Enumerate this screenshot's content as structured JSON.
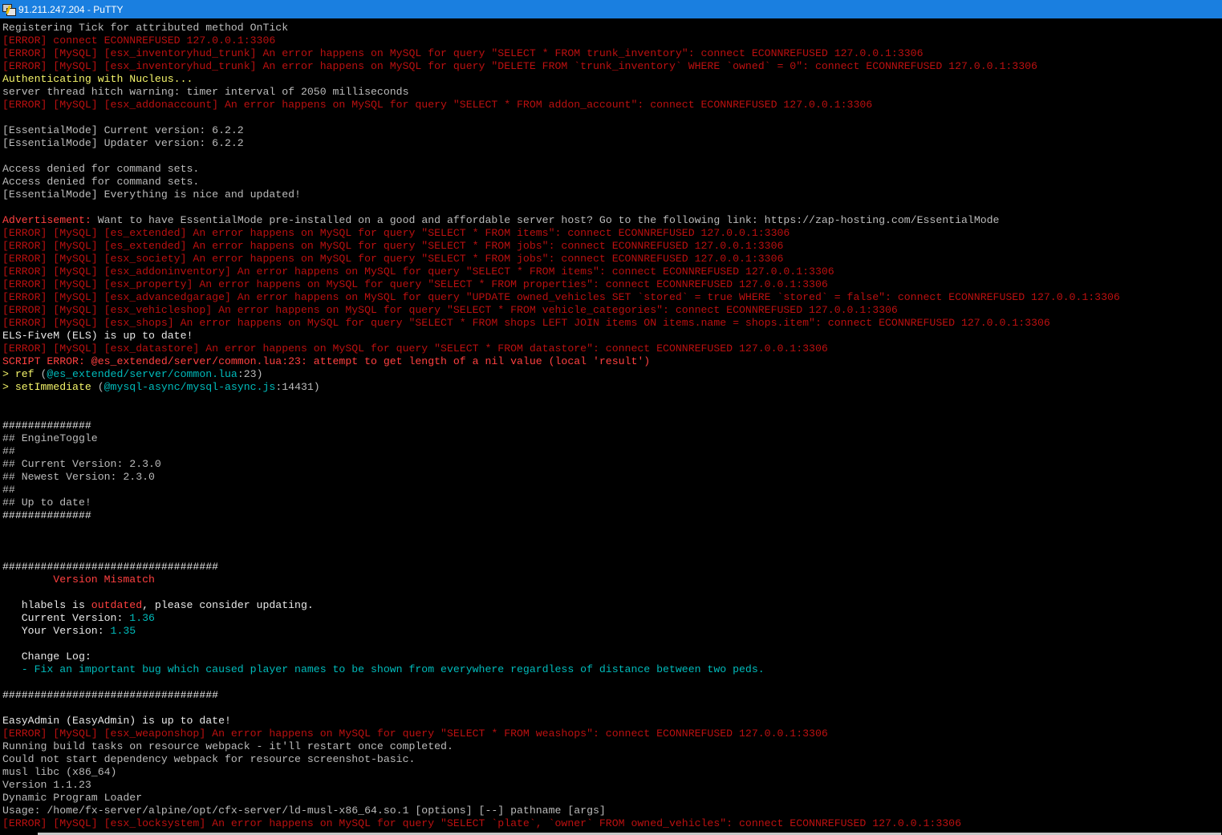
{
  "window": {
    "title": "91.211.247.204 - PuTTY",
    "icon": "putty-icon"
  },
  "colors": {
    "title_bar": "#1a7fe0",
    "background": "#000000",
    "default_text": "#bbbbbb",
    "error_red": "#bb1010",
    "script_error": "#ff4040",
    "yellow": "#f4f46a",
    "cyan": "#00bbbb"
  },
  "console": {
    "lines": [
      [
        {
          "t": "Registering Tick for attributed method OnTick",
          "c": "white"
        }
      ],
      [
        {
          "t": "[ERROR] connect ECONNREFUSED 127.0.0.1:3306",
          "c": "red"
        }
      ],
      [
        {
          "t": "[ERROR] [MySQL] [esx_inventoryhud_trunk] An error happens on MySQL for query \"SELECT * FROM trunk_inventory\": connect ECONNREFUSED 127.0.0.1:3306",
          "c": "red"
        }
      ],
      [
        {
          "t": "[ERROR] [MySQL] [esx_inventoryhud_trunk] An error happens on MySQL for query \"DELETE FROM `trunk_inventory` WHERE `owned` = 0\": connect ECONNREFUSED 127.0.0.1:3306",
          "c": "red"
        }
      ],
      [
        {
          "t": "Authenticating with Nucleus...",
          "c": "yellow"
        }
      ],
      [
        {
          "t": "server thread hitch warning: timer interval of 2050 milliseconds",
          "c": "white"
        }
      ],
      [
        {
          "t": "[ERROR] [MySQL] [esx_addonaccount] An error happens on MySQL for query \"SELECT * FROM addon_account\": connect ECONNREFUSED 127.0.0.1:3306",
          "c": "red"
        }
      ],
      [],
      [
        {
          "t": "[EssentialMode] Current version: 6.2.2",
          "c": "white"
        }
      ],
      [
        {
          "t": "[EssentialMode] Updater version: 6.2.2",
          "c": "white"
        }
      ],
      [],
      [
        {
          "t": "Access denied for command sets.",
          "c": "white"
        }
      ],
      [
        {
          "t": "Access denied for command sets.",
          "c": "white"
        }
      ],
      [
        {
          "t": "[EssentialMode] Everything is nice and updated!",
          "c": "white"
        }
      ],
      [],
      [
        {
          "t": "Advertisement:",
          "c": "bred"
        },
        {
          "t": " Want to have EssentialMode pre-installed on a good and affordable server host? Go to the following link: https://zap-hosting.com/EssentialMode",
          "c": "white"
        }
      ],
      [
        {
          "t": "[ERROR] [MySQL] [es_extended] An error happens on MySQL for query \"SELECT * FROM items\": connect ECONNREFUSED 127.0.0.1:3306",
          "c": "red"
        }
      ],
      [
        {
          "t": "[ERROR] [MySQL] [es_extended] An error happens on MySQL for query \"SELECT * FROM jobs\": connect ECONNREFUSED 127.0.0.1:3306",
          "c": "red"
        }
      ],
      [
        {
          "t": "[ERROR] [MySQL] [esx_society] An error happens on MySQL for query \"SELECT * FROM jobs\": connect ECONNREFUSED 127.0.0.1:3306",
          "c": "red"
        }
      ],
      [
        {
          "t": "[ERROR] [MySQL] [esx_addoninventory] An error happens on MySQL for query \"SELECT * FROM items\": connect ECONNREFUSED 127.0.0.1:3306",
          "c": "red"
        }
      ],
      [
        {
          "t": "[ERROR] [MySQL] [esx_property] An error happens on MySQL for query \"SELECT * FROM properties\": connect ECONNREFUSED 127.0.0.1:3306",
          "c": "red"
        }
      ],
      [
        {
          "t": "[ERROR] [MySQL] [esx_advancedgarage] An error happens on MySQL for query \"UPDATE owned_vehicles SET `stored` = true WHERE `stored` = false\": connect ECONNREFUSED 127.0.0.1:3306",
          "c": "red"
        }
      ],
      [
        {
          "t": "[ERROR] [MySQL] [esx_vehicleshop] An error happens on MySQL for query \"SELECT * FROM vehicle_categories\": connect ECONNREFUSED 127.0.0.1:3306",
          "c": "red"
        }
      ],
      [
        {
          "t": "[ERROR] [MySQL] [esx_shops] An error happens on MySQL for query \"SELECT * FROM shops LEFT JOIN items ON items.name = shops.item\": connect ECONNREFUSED 127.0.0.1:3306",
          "c": "red"
        }
      ],
      [
        {
          "t": "ELS-FiveM (ELS) is up to date!",
          "c": "bright"
        }
      ],
      [
        {
          "t": "[ERROR] [MySQL] [esx_datastore] An error happens on MySQL for query \"SELECT * FROM datastore\": connect ECONNREFUSED 127.0.0.1:3306",
          "c": "red"
        }
      ],
      [
        {
          "t": "SCRIPT ERROR: @es_extended/server/common.lua:23: attempt to get length of a nil value (local 'result')",
          "c": "bred"
        }
      ],
      [
        {
          "t": "> ref ",
          "c": "yellow"
        },
        {
          "t": "(",
          "c": "white"
        },
        {
          "t": "@es_extended/server/common.lua",
          "c": "cyan"
        },
        {
          "t": ":23)",
          "c": "white"
        }
      ],
      [
        {
          "t": "> setImmediate ",
          "c": "yellow"
        },
        {
          "t": "(",
          "c": "white"
        },
        {
          "t": "@mysql-async/mysql-async.js",
          "c": "cyan"
        },
        {
          "t": ":14431)",
          "c": "white"
        }
      ],
      [],
      [],
      [
        {
          "t": "##############",
          "c": "bright"
        }
      ],
      [
        {
          "t": "## EngineToggle",
          "c": "white"
        }
      ],
      [
        {
          "t": "##",
          "c": "white"
        }
      ],
      [
        {
          "t": "## Current Version: 2.3.0",
          "c": "white"
        }
      ],
      [
        {
          "t": "## Newest Version: 2.3.0",
          "c": "white"
        }
      ],
      [
        {
          "t": "##",
          "c": "white"
        }
      ],
      [
        {
          "t": "## Up to date!",
          "c": "white"
        }
      ],
      [
        {
          "t": "##############",
          "c": "bright"
        }
      ],
      [],
      [],
      [],
      [
        {
          "t": "##################################",
          "c": "bright"
        }
      ],
      [
        {
          "t": "        Version Mismatch",
          "c": "bred"
        }
      ],
      [],
      [
        {
          "t": "   hlabels is ",
          "c": "bright"
        },
        {
          "t": "outdated",
          "c": "bred"
        },
        {
          "t": ", please consider updating.",
          "c": "bright"
        }
      ],
      [
        {
          "t": "   Current Version: ",
          "c": "bright"
        },
        {
          "t": "1.36",
          "c": "cyan"
        }
      ],
      [
        {
          "t": "   Your Version: ",
          "c": "bright"
        },
        {
          "t": "1.35",
          "c": "cyan"
        }
      ],
      [],
      [
        {
          "t": "   Change Log:",
          "c": "bright"
        }
      ],
      [
        {
          "t": "   - Fix an important bug which caused player names to be shown from everywhere regardless of distance between two peds.",
          "c": "cyan"
        }
      ],
      [],
      [
        {
          "t": "##################################",
          "c": "bright"
        }
      ],
      [],
      [
        {
          "t": "EasyAdmin (EasyAdmin) is up to date!",
          "c": "bright"
        }
      ],
      [
        {
          "t": "[ERROR] [MySQL] [esx_weaponshop] An error happens on MySQL for query \"SELECT * FROM weashops\": connect ECONNREFUSED 127.0.0.1:3306",
          "c": "red"
        }
      ],
      [
        {
          "t": "Running build tasks on resource webpack - it'll restart once completed.",
          "c": "white"
        }
      ],
      [
        {
          "t": "Could not start dependency webpack for resource screenshot-basic.",
          "c": "white"
        }
      ],
      [
        {
          "t": "musl libc (x86_64)",
          "c": "white"
        }
      ],
      [
        {
          "t": "Version 1.1.23",
          "c": "white"
        }
      ],
      [
        {
          "t": "Dynamic Program Loader",
          "c": "white"
        }
      ],
      [
        {
          "t": "Usage: /home/fx-server/alpine/opt/cfx-server/ld-musl-x86_64.so.1 [options] [--] pathname [args]",
          "c": "white"
        }
      ],
      [
        {
          "t": "[ERROR] [MySQL] [esx_locksystem] An error happens on MySQL for query \"SELECT `plate`, `owner` FROM owned_vehicles\": connect ECONNREFUSED 127.0.0.1:3306",
          "c": "red"
        }
      ]
    ]
  }
}
